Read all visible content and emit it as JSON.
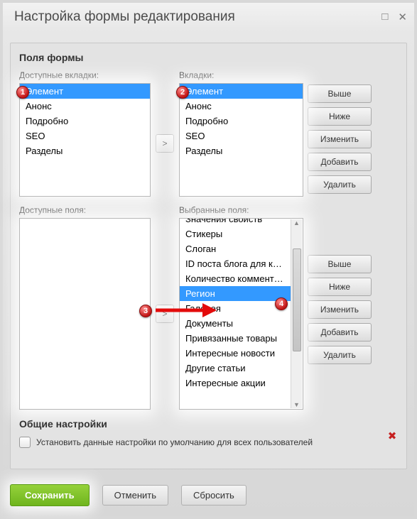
{
  "window": {
    "title": "Настройка формы редактирования"
  },
  "fields_section": {
    "heading": "Поля формы",
    "available_tabs_label": "Доступные вкладки:",
    "tabs_label": "Вкладки:",
    "available_fields_label": "Доступные поля:",
    "selected_fields_label": "Выбранные поля:"
  },
  "available_tabs": [
    "Элемент",
    "Анонс",
    "Подробно",
    "SEO",
    "Разделы"
  ],
  "tabs": [
    "Элемент",
    "Анонс",
    "Подробно",
    "SEO",
    "Разделы"
  ],
  "available_fields": [],
  "selected_fields": [
    "Значения свойств",
    "Стикеры",
    "Слоган",
    "ID поста блога для комм",
    "Количество комментари",
    "Регион",
    "Галерея",
    "Документы",
    "Привязанные товары",
    "Интересные новости",
    "Другие статьи",
    "Интересные акции"
  ],
  "selected_index": {
    "available_tabs": 0,
    "tabs": 0,
    "selected_fields": 5
  },
  "buttons": {
    "up": "Выше",
    "down": "Ниже",
    "edit": "Изменить",
    "add": "Добавить",
    "delete": "Удалить",
    "move": ">"
  },
  "general": {
    "heading": "Общие настройки",
    "checkbox_label": "Установить данные настройки по умолчанию для всех пользователей"
  },
  "footer": {
    "save": "Сохранить",
    "cancel": "Отменить",
    "reset": "Сбросить"
  },
  "markers": {
    "m1": "1",
    "m2": "2",
    "m3": "3",
    "m4": "4"
  }
}
